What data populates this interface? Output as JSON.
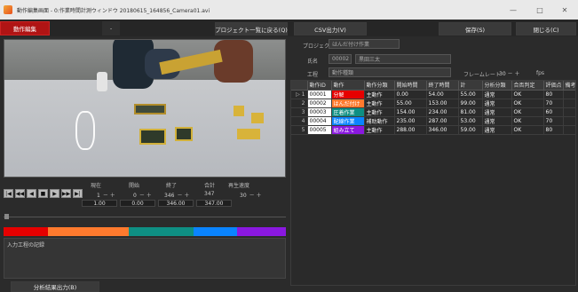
{
  "window": {
    "title": "動作編集画面 - 0:作業時間計測ウィンドウ 20180615_164856_Camera01.avi",
    "min_glyph": "—",
    "max_glyph": "□",
    "close_glyph": "✕"
  },
  "toolbar": {
    "edit_label": "動作編集",
    "dash_label": "-",
    "project_list_label": "プロジェクト一覧に戻る(Q)",
    "csv_label": "CSV出力(V)",
    "save_label": "保存(S)",
    "close_label": "閉じる(C)"
  },
  "info": {
    "project_label": "プロジェクト",
    "project_value": "はんだ付け作業",
    "name_label": "氏名",
    "employee_id": "00002",
    "employee_name": "黒田三太",
    "process_label": "工程",
    "process_value": "動作種類",
    "frame_label": "フレームレート",
    "frame_value": "30",
    "fps_unit": "fps"
  },
  "controls": {
    "current_label": "現在",
    "start_label": "開始",
    "end_label": "終了",
    "total_label": "合計",
    "speed_label": "再生速度",
    "current_spin": "1",
    "start_spin": "0",
    "end_spin": "346",
    "total_spin": "347",
    "speed_spin": "30",
    "current_value": "1.00",
    "start_value": "0.00",
    "end_value": "346.00",
    "total_value": "347.00",
    "btn_first": "|◀",
    "btn_prev": "◀◀",
    "btn_back": "◀",
    "btn_stop": "■",
    "btn_play": "▶",
    "btn_next": "▶▶",
    "btn_last": "▶|"
  },
  "timeline": {
    "segments": [
      {
        "color": "#e60000",
        "fraction": 0.156
      },
      {
        "color": "#ff7a2e",
        "fraction": 0.286
      },
      {
        "color": "#0e8f83",
        "fraction": 0.231
      },
      {
        "color": "#0a84ff",
        "fraction": 0.153
      },
      {
        "color": "#8a18e0",
        "fraction": 0.174
      }
    ]
  },
  "memo": {
    "text": "入力工程の記録"
  },
  "bottom": {
    "analysis_label": "分析結果出力(B)"
  },
  "table": {
    "headers": [
      "",
      "動作ID",
      "動作",
      "動作分類",
      "開始時間",
      "終了時間",
      "計",
      "分析分類",
      "合否判定",
      "評価点",
      "備考"
    ],
    "rows": [
      {
        "marker": "▷ 1",
        "id": "00001",
        "action": "分解",
        "action_color": "#e60000",
        "category": "主動作",
        "start": "0.00",
        "end": "54.00",
        "total": "55.00",
        "class": "通常",
        "judge": "OK",
        "score": "80",
        "note": ""
      },
      {
        "marker": "2",
        "id": "00002",
        "action": "はんだ付け",
        "action_color": "#ff7a2e",
        "category": "主動作",
        "start": "55.00",
        "end": "153.00",
        "total": "99.00",
        "class": "通常",
        "judge": "OK",
        "score": "70",
        "note": ""
      },
      {
        "marker": "3",
        "id": "00003",
        "action": "圧着作業",
        "action_color": "#0e8f83",
        "category": "主動作",
        "start": "154.00",
        "end": "234.00",
        "total": "81.00",
        "class": "通常",
        "judge": "OK",
        "score": "60",
        "note": ""
      },
      {
        "marker": "4",
        "id": "00004",
        "action": "配線作業",
        "action_color": "#0a84ff",
        "category": "補助動作",
        "start": "235.00",
        "end": "287.00",
        "total": "53.00",
        "class": "通常",
        "judge": "OK",
        "score": "70",
        "note": ""
      },
      {
        "marker": "5",
        "id": "00005",
        "action": "組み立て",
        "action_color": "#8a18e0",
        "category": "主動作",
        "start": "288.00",
        "end": "346.00",
        "total": "59.00",
        "class": "通常",
        "judge": "OK",
        "score": "80",
        "note": ""
      }
    ]
  }
}
